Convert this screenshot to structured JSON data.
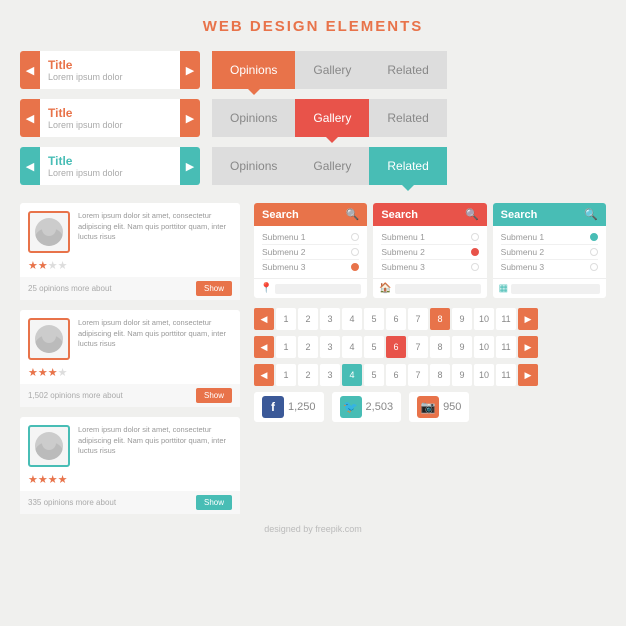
{
  "page": {
    "title": "WEB DESIGN ELEMENTS",
    "footer": "designed by freepik.com"
  },
  "nav_banners": [
    {
      "title": "Title",
      "subtitle": "Lorem ipsum dolor",
      "color": "orange"
    },
    {
      "title": "Title",
      "subtitle": "Lorem ipsum dolor",
      "color": "orange"
    },
    {
      "title": "Title",
      "subtitle": "Lorem ipsum dolor",
      "color": "teal"
    }
  ],
  "tab_rows": [
    {
      "tabs": [
        "Opinions",
        "Gallery",
        "Related"
      ],
      "active": 0,
      "active_color": "orange"
    },
    {
      "tabs": [
        "Opinions",
        "Gallery",
        "Related"
      ],
      "active": 1,
      "active_color": "red"
    },
    {
      "tabs": [
        "Opinions",
        "Gallery",
        "Related"
      ],
      "active": 2,
      "active_color": "teal"
    }
  ],
  "opinion_cards": [
    {
      "text": "Lorem ipsum dolor sit amet, consectetur adipiscing elit. Nam quis porttitor quam, inter luctus risus",
      "stars": 2,
      "total_stars": 4,
      "count_text": "25 opinions more about",
      "show_label": "Show",
      "color": "orange"
    },
    {
      "text": "Lorem ipsum dolor sit amet, consectetur adipiscing elit. Nam quis porttitor quam, inter luctus risus",
      "stars": 3,
      "total_stars": 4,
      "count_text": "1,502 opinions more about",
      "show_label": "Show",
      "color": "orange"
    },
    {
      "text": "Lorem ipsum dolor sit amet, consectetur adipiscing elit. Nam quis porttitor quam, inter luctus risus",
      "stars": 4,
      "total_stars": 4,
      "count_text": "335 opinions more about",
      "show_label": "Show",
      "color": "teal"
    }
  ],
  "search_panels": [
    {
      "label": "Search",
      "color": "orange",
      "submenus": [
        "Submenu 1",
        "Submenu 2",
        "Submenu 3"
      ],
      "active_dot": 2,
      "location_color": "orange"
    },
    {
      "label": "Search",
      "color": "red",
      "submenus": [
        "Submenu 1",
        "Submenu 2",
        "Submenu 3"
      ],
      "active_dot": 1,
      "location_color": "orange"
    },
    {
      "label": "Search",
      "color": "teal",
      "submenus": [
        "Submenu 1",
        "Submenu 2",
        "Submenu 3"
      ],
      "active_dot": 0,
      "location_color": "teal"
    }
  ],
  "pagination_rows": [
    {
      "pages": [
        1,
        2,
        3,
        4,
        5,
        6,
        7,
        8,
        9,
        10,
        11
      ],
      "active": 7,
      "color": "orange"
    },
    {
      "pages": [
        1,
        2,
        3,
        4,
        5,
        6,
        7,
        8,
        9,
        10,
        11
      ],
      "active": 5,
      "color": "red"
    },
    {
      "pages": [
        1,
        2,
        3,
        4,
        5,
        6,
        7,
        8,
        9,
        10,
        11
      ],
      "active": 4,
      "color": "teal"
    }
  ],
  "social_stats": [
    {
      "platform": "f",
      "count": "1,250",
      "color": "facebook"
    },
    {
      "platform": "t",
      "count": "2,503",
      "color": "twitter"
    },
    {
      "platform": "ig",
      "count": "950",
      "color": "instagram"
    }
  ]
}
